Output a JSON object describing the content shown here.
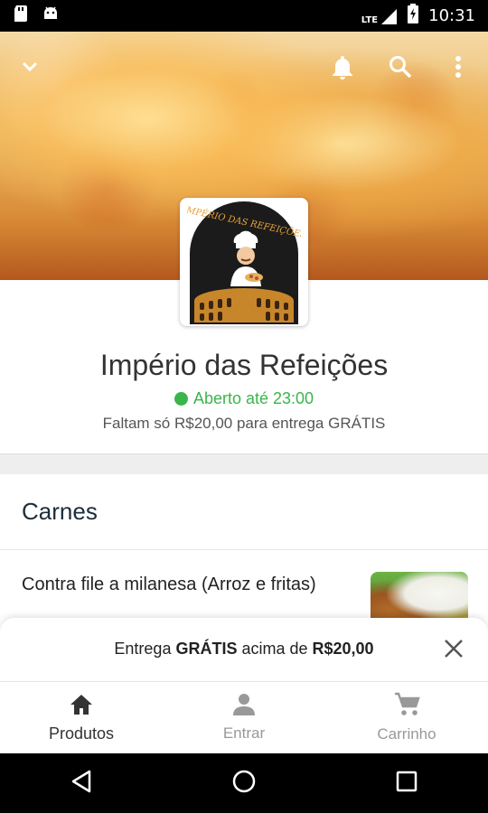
{
  "status_bar": {
    "time": "10:31",
    "network": "LTE"
  },
  "header": {
    "back_icon": "chevron-down-icon",
    "actions": [
      "bell-icon",
      "search-icon",
      "more-vert-icon"
    ]
  },
  "store": {
    "logo_text": "IMPÉRIO DAS REFEIÇÕES",
    "name": "Império das Refeições",
    "status": "Aberto até 23:00",
    "delivery_note": "Faltam só R$20,00 para entrega GRÁTIS"
  },
  "menu": {
    "category": "Carnes",
    "product_name": "Contra file a milanesa (Arroz e fritas)"
  },
  "promo": {
    "prefix": "Entrega ",
    "free": "GRÁTIS",
    "middle": " acima de ",
    "amount": "R$20,00"
  },
  "bottom_nav": {
    "items": [
      {
        "label": "Produtos",
        "icon": "home-icon"
      },
      {
        "label": "Entrar",
        "icon": "person-icon"
      },
      {
        "label": "Carrinho",
        "icon": "cart-icon"
      }
    ]
  },
  "colors": {
    "open_green": "#3ab54a",
    "title_dark": "#1d2d3a"
  }
}
